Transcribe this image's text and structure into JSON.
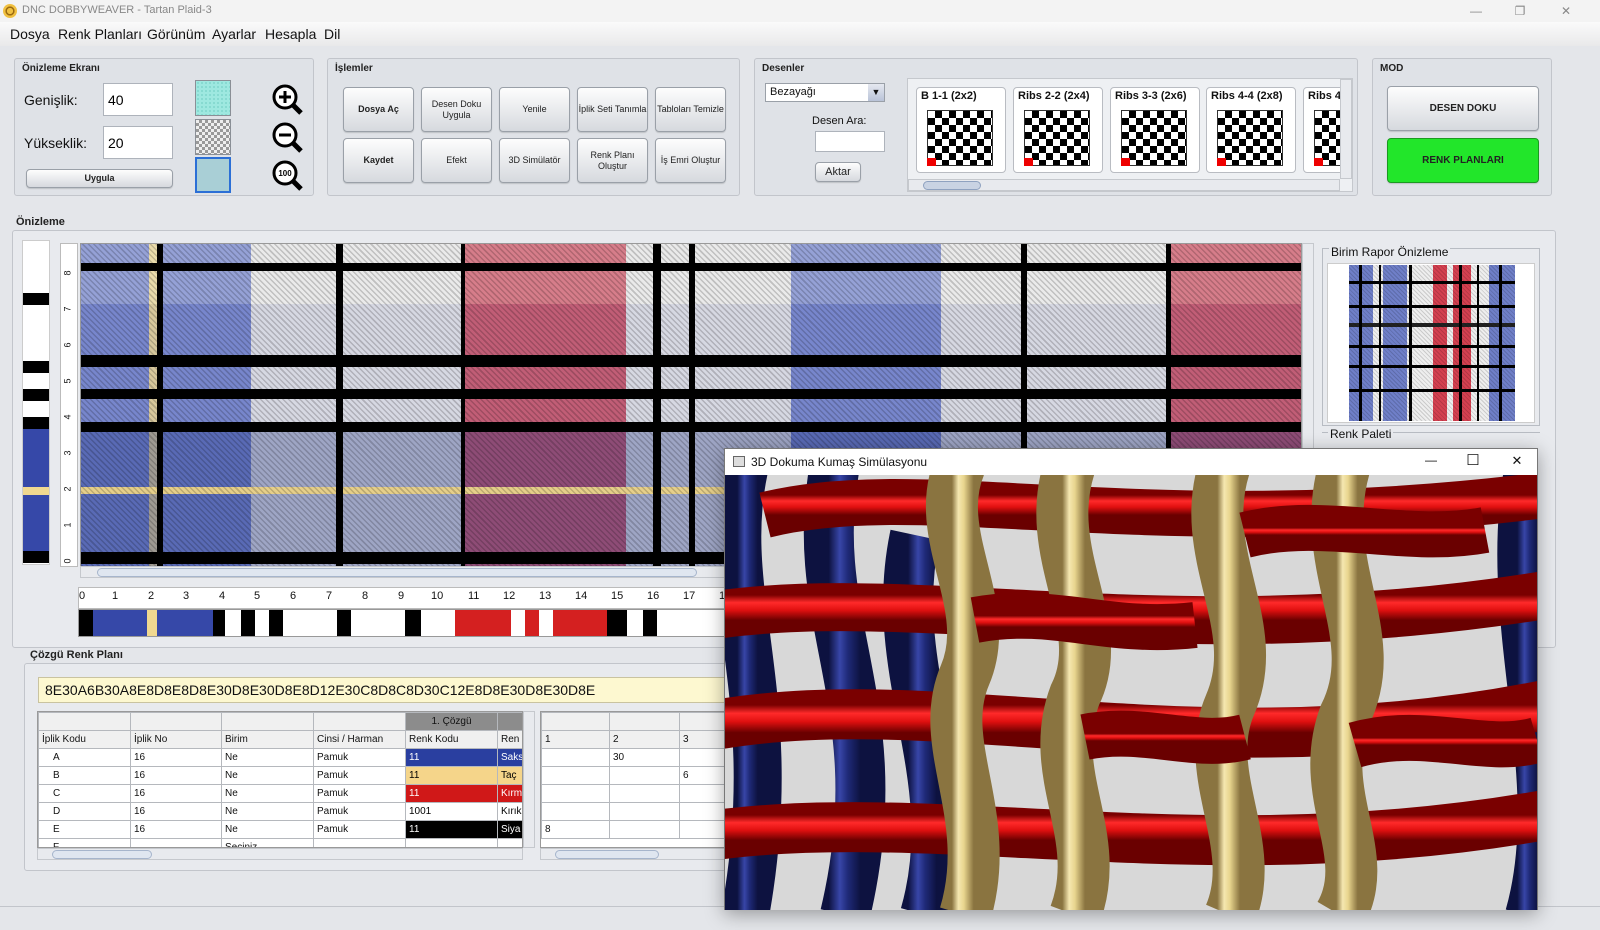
{
  "window": {
    "title": "DNC DOBBYWEAVER - Tartan Plaid-3",
    "min": "—",
    "max": "❐",
    "close": "✕"
  },
  "menu": [
    "Dosya",
    "Renk Planları",
    "Görünüm",
    "Ayarlar",
    "Hesapla",
    "Dil"
  ],
  "onizlemeEkrani": {
    "title": "Önizleme Ekranı",
    "width_label": "Genişlik:",
    "width_value": "40",
    "height_label": "Yükseklik:",
    "height_value": "20",
    "apply": "Uygula",
    "zoom100": "100"
  },
  "islemler": {
    "title": "İşlemler",
    "buttons": [
      "Dosya Aç",
      "Desen Doku Uygula",
      "Yenile",
      "İplik Seti Tanımla",
      "Tabloları Temizle",
      "Kaydet",
      "Efekt",
      "3D Simülatör",
      "Renk Planı Oluştur",
      "İş Emri Oluştur"
    ]
  },
  "desenler": {
    "title": "Desenler",
    "select": "Bezayağı",
    "search_label": "Desen Ara:",
    "search_value": "",
    "export": "Aktar",
    "thumbs": [
      "B 1-1 (2x2)",
      "Ribs 2-2 (2x4)",
      "Ribs 3-3 (2x6)",
      "Ribs 4-4 (2x8)",
      "Ribs 4"
    ]
  },
  "mod": {
    "title": "MOD",
    "desen": "DESEN DOKU",
    "renk": "RENK PLANLARI"
  },
  "onizleme": {
    "title": "Önizleme",
    "vruler": [
      "0",
      "1",
      "2",
      "3",
      "4",
      "5",
      "6",
      "7",
      "8"
    ],
    "hruler": [
      "0",
      "1",
      "2",
      "3",
      "4",
      "5",
      "6",
      "7",
      "8",
      "9",
      "10",
      "11",
      "12",
      "13",
      "14",
      "15",
      "16",
      "17",
      "1"
    ]
  },
  "birimRapor": {
    "title": "Birim Rapor Önizleme"
  },
  "renkPaleti": {
    "title": "Renk Paleti"
  },
  "cozgu": {
    "title": "Çözgü Renk Planı",
    "code": "8E30A6B30A8E8D8E8D8E30D8E30D8E8D12E30C8D8C8D30C12E8D8E30D8E30D8E",
    "group_header": "1. Çözgü",
    "headers": [
      "İplik Kodu",
      "İplik No",
      "Birim",
      "Cinsi / Harman",
      "Renk Kodu",
      "Ren"
    ],
    "rows": [
      {
        "kod": "A",
        "no": "16",
        "birim": "Ne",
        "cins": "Pamuk",
        "renk": "11",
        "ad": "Saks",
        "color": "#2a3fa0",
        "fg": "#ffffff"
      },
      {
        "kod": "B",
        "no": "16",
        "birim": "Ne",
        "cins": "Pamuk",
        "renk": "11",
        "ad": "Taç",
        "color": "#f5d58a",
        "fg": "#000000"
      },
      {
        "kod": "C",
        "no": "16",
        "birim": "Ne",
        "cins": "Pamuk",
        "renk": "11",
        "ad": "Kırm",
        "color": "#d01818",
        "fg": "#ffffff"
      },
      {
        "kod": "D",
        "no": "16",
        "birim": "Ne",
        "cins": "Pamuk",
        "renk": "1001",
        "ad": "Kırık",
        "color": "#ffffff",
        "fg": "#000000"
      },
      {
        "kod": "E",
        "no": "16",
        "birim": "Ne",
        "cins": "Pamuk",
        "renk": "11",
        "ad": "Siya",
        "color": "#000000",
        "fg": "#ffffff"
      }
    ],
    "partial_row": {
      "kod": "F",
      "birim": "Seçiniz"
    },
    "right_headers": [
      "1",
      "2",
      "3"
    ],
    "right_rows": [
      [
        "",
        "30",
        ""
      ],
      [
        "",
        "",
        "6"
      ],
      [
        "",
        "",
        ""
      ],
      [
        "",
        "",
        ""
      ],
      [
        "8",
        "",
        ""
      ]
    ]
  },
  "sim": {
    "title": "3D Dokuma Kumaş Simülasyonu",
    "min": "—",
    "max": "☐",
    "close": "✕"
  },
  "colors": {
    "red": "#e01010",
    "blue": "#1f2a78",
    "cream": "#e8d58e",
    "green": "#22e62a"
  }
}
